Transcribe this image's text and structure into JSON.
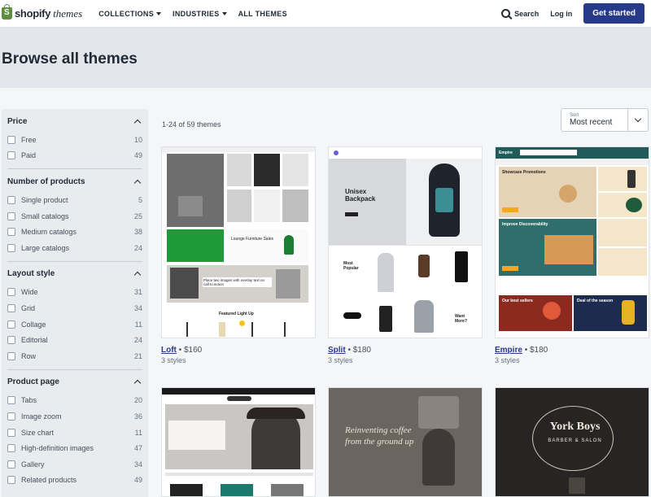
{
  "header": {
    "logo_brand": "shopify",
    "logo_suffix": "themes",
    "nav": [
      "COLLECTIONS",
      "INDUSTRIES",
      "ALL THEMES"
    ],
    "search": "Search",
    "login": "Log in",
    "cta": "Get started"
  },
  "page": {
    "title": "Browse all themes",
    "results": "1-24 of 59 themes"
  },
  "sort": {
    "label": "Sort",
    "value": "Most recent"
  },
  "filters": [
    {
      "title": "Price",
      "options": [
        {
          "label": "Free",
          "count": "10"
        },
        {
          "label": "Paid",
          "count": "49"
        }
      ]
    },
    {
      "title": "Number of products",
      "options": [
        {
          "label": "Single product",
          "count": "5"
        },
        {
          "label": "Small catalogs",
          "count": "25"
        },
        {
          "label": "Medium catalogs",
          "count": "38"
        },
        {
          "label": "Large catalogs",
          "count": "24"
        }
      ]
    },
    {
      "title": "Layout style",
      "options": [
        {
          "label": "Wide",
          "count": "31"
        },
        {
          "label": "Grid",
          "count": "34"
        },
        {
          "label": "Collage",
          "count": "11"
        },
        {
          "label": "Editorial",
          "count": "24"
        },
        {
          "label": "Row",
          "count": "21"
        }
      ]
    },
    {
      "title": "Product page",
      "options": [
        {
          "label": "Tabs",
          "count": "20"
        },
        {
          "label": "Image zoom",
          "count": "36"
        },
        {
          "label": "Size chart",
          "count": "11"
        },
        {
          "label": "High-definition images",
          "count": "47"
        },
        {
          "label": "Gallery",
          "count": "34"
        },
        {
          "label": "Related products",
          "count": "49"
        }
      ]
    }
  ],
  "themes": [
    {
      "name": "Loft",
      "price": "$160",
      "styles": "3 styles"
    },
    {
      "name": "Split",
      "price": "$180",
      "styles": "3 styles"
    },
    {
      "name": "Empire",
      "price": "$180",
      "styles": "3 styles"
    }
  ],
  "thumb_text": {
    "split_headline": "Unisex Backpack",
    "split_badge": "Most Popular",
    "split_want": "Want More?",
    "empire_logo": "Empire",
    "empire_promo": "Showcase Promotions",
    "empire_promo2": "Improve Discoverability",
    "empire_sellers": "Our best sellers",
    "empire_season": "Deal of the season",
    "loft_banner": "Place two images with overlay text on call to action",
    "loft_furniture": "Lounge Furniture Sales",
    "loft_featured": "Featured Light Up",
    "coffee_line1": "Reinventing coffee",
    "coffee_line2": "from the ground up",
    "york_title": "York Boys",
    "york_sub": "BARBER & SALON"
  },
  "colors": {
    "accent": "#273a8a",
    "link": "#273a8a",
    "loft_green": "#1f9a3a",
    "empire_teal": "#1e5b5a",
    "empire_orange": "#f5a623"
  }
}
